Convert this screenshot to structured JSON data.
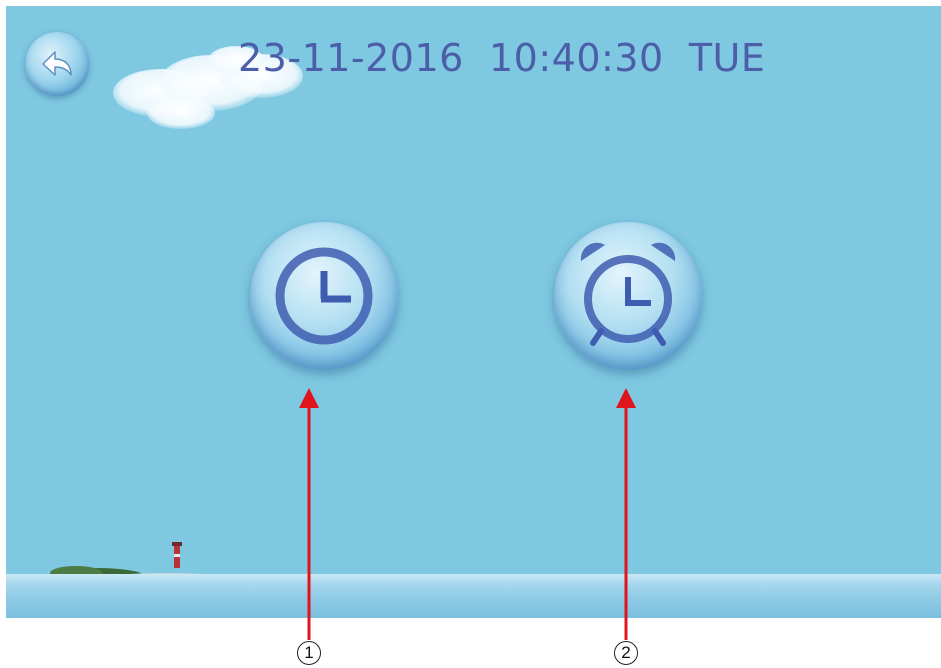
{
  "status_bar": {
    "datetime": "23-11-2016  10:40:30  TUE"
  },
  "buttons": {
    "back": {
      "icon": "back-arrow-icon"
    },
    "clock": {
      "icon": "clock-icon"
    },
    "alarm": {
      "icon": "alarm-clock-icon"
    }
  },
  "callouts": {
    "marker_1": "1",
    "marker_2": "2",
    "arrow_color": "#e0141c"
  },
  "colors": {
    "screen_background": "#7ec8e1",
    "datetime_text": "#4d5ea8",
    "icon_stroke": "#3f5db0"
  }
}
